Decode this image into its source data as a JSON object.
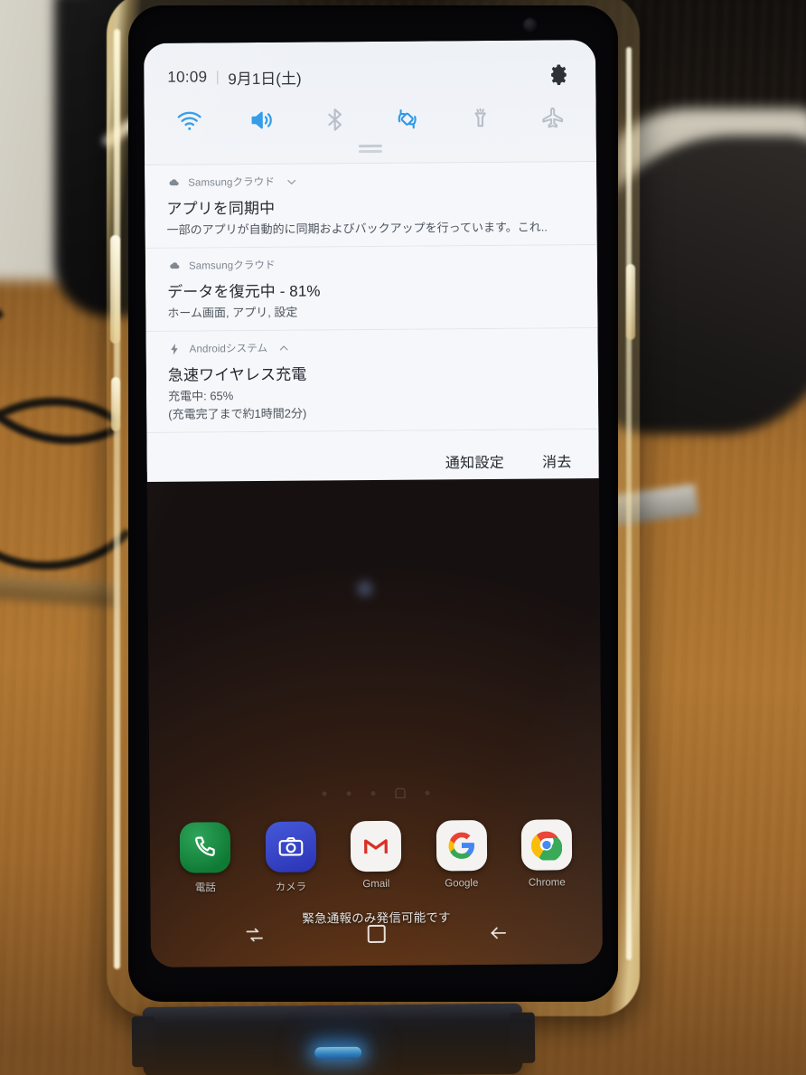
{
  "statusbar": {
    "time": "10:09",
    "date": "9月1日(土)",
    "settings_icon": "gear-icon"
  },
  "quick_toggles": [
    {
      "name": "wifi",
      "icon": "wifi-icon",
      "active": true
    },
    {
      "name": "sound",
      "icon": "sound-icon",
      "active": true
    },
    {
      "name": "bluetooth",
      "icon": "bluetooth-icon",
      "active": false
    },
    {
      "name": "auto-rotate",
      "icon": "auto-rotate-icon",
      "active": true
    },
    {
      "name": "flashlight",
      "icon": "flashlight-icon",
      "active": false
    },
    {
      "name": "airplane-mode",
      "icon": "airplane-icon",
      "active": false
    }
  ],
  "notifications": [
    {
      "app": "Samsungクラウド",
      "app_icon": "cloud-icon",
      "expandable": true,
      "chevron": "chevron-down-icon",
      "title": "アプリを同期中",
      "body": "一部のアプリが自動的に同期およびバックアップを行っています。これ..",
      "body2": ""
    },
    {
      "app": "Samsungクラウド",
      "app_icon": "cloud-icon",
      "expandable": false,
      "chevron": "",
      "title": "データを復元中 - 81%",
      "body": "ホーム画面, アプリ, 設定",
      "body2": ""
    },
    {
      "app": "Androidシステム",
      "app_icon": "bolt-icon",
      "expandable": true,
      "chevron": "chevron-up-icon",
      "title": "急速ワイヤレス充電",
      "body": "充電中: 65%",
      "body2": "(充電完了まで約1時間2分)"
    }
  ],
  "shade_footer": {
    "settings_label": "通知設定",
    "clear_label": "消去"
  },
  "home": {
    "emergency_text": "緊急通報のみ発信可能です",
    "dock": [
      {
        "label": "電話",
        "icon": "phone-icon"
      },
      {
        "label": "カメラ",
        "icon": "camera-icon"
      },
      {
        "label": "Gmail",
        "icon": "gmail-icon"
      },
      {
        "label": "Google",
        "icon": "google-icon"
      },
      {
        "label": "Chrome",
        "icon": "chrome-icon"
      }
    ],
    "navbar": [
      {
        "name": "recents",
        "icon": "recents-icon"
      },
      {
        "name": "home",
        "icon": "home-square-icon"
      },
      {
        "name": "back",
        "icon": "back-arrow-icon"
      }
    ]
  },
  "colors": {
    "accent_active": "#2f9ae8",
    "toggle_inactive": "#b9bfc8",
    "shade_bg": "#f5f6f9",
    "text_primary": "#232730",
    "text_secondary": "#7b848f",
    "led": "#1b8fe8"
  }
}
